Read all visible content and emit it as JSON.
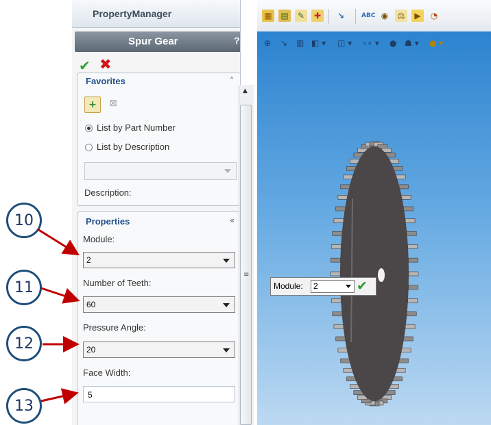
{
  "property_manager": {
    "header_title": "PropertyManager",
    "feature_title": "Spur Gear",
    "help_label": "?",
    "ok_symbol": "✔",
    "cancel_symbol": "✖",
    "favorites": {
      "title": "Favorites",
      "list_by_part_number": "List by Part Number",
      "list_by_description": "List by Description",
      "selected_option": "List by Part Number",
      "description_label": "Description:"
    },
    "properties": {
      "title": "Properties",
      "module_label": "Module:",
      "module_value": "2",
      "teeth_label": "Number of Teeth:",
      "teeth_value": "60",
      "pressure_angle_label": "Pressure Angle:",
      "pressure_angle_value": "20",
      "face_width_label": "Face Width:",
      "face_width_value": "5"
    }
  },
  "callouts": [
    "10",
    "11",
    "12",
    "13"
  ],
  "graphics_area": {
    "module_popup_label": "Module:",
    "module_popup_value": "2",
    "toolbar_icons": [
      "assembly-icon",
      "book-icon",
      "drawing-icon",
      "add-icon",
      "sketch-icon",
      "spelling-icon",
      "lens-icon",
      "scale-icon",
      "arrow-icon",
      "gauge-icon"
    ],
    "background_top": "#2c83cf",
    "background_bottom": "#bcd9f2"
  },
  "accent_colors": {
    "callout_border": "#1f4e79",
    "arrow": "#c00000",
    "title_bar": "#6b7784"
  }
}
